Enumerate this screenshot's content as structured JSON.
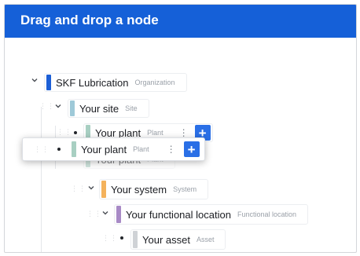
{
  "header": {
    "title": "Drag and drop a node"
  },
  "colors": {
    "header_bg": "#1560d8",
    "organization": "#1c5fd6",
    "site": "#9ec9d8",
    "plant": "#a8cfc2",
    "system": "#f4b25c",
    "functional_location": "#a88ac6",
    "asset": "#cfd2d6",
    "add_button": "#2a6fe6"
  },
  "tree": {
    "organization": {
      "name": "SKF Lubrication",
      "type": "Organization"
    },
    "site": {
      "name": "Your site",
      "type": "Site"
    },
    "plant": {
      "name": "Your plant",
      "type": "Plant"
    },
    "plant_ghost_lower": {
      "name": "Your plant",
      "type": "Plant"
    },
    "system": {
      "name": "Your system",
      "type": "System"
    },
    "functional_location": {
      "name": "Your functional location",
      "type": "Functional location"
    },
    "asset": {
      "name": "Your asset",
      "type": "Asset"
    }
  },
  "dragging": {
    "name": "Your plant",
    "type": "Plant",
    "add_label": "+",
    "menu_label": "⋮"
  }
}
